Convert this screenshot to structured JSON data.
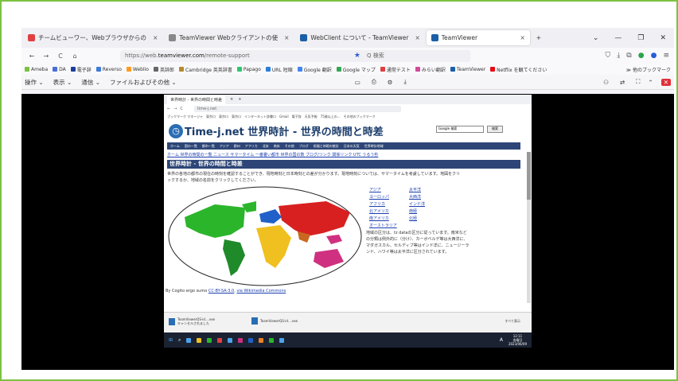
{
  "tabs": [
    {
      "label": "チームビューワー、Webブラウザからの",
      "fav_color": "#4a6ed8"
    },
    {
      "label": "TeamViewer Webクライアントの使",
      "fav_color": "#6b6b6b"
    },
    {
      "label": "WebClient について - TeamViewer",
      "fav_color": "#1b5fa6"
    },
    {
      "label": "TeamViewer",
      "fav_color": "#1b5fa6"
    }
  ],
  "tab_close": "×",
  "new_tab": "+",
  "window_controls": [
    "⌄",
    "—",
    "❐",
    "✕"
  ],
  "nav": {
    "back": "←",
    "forward": "→",
    "reload": "C",
    "home": "⌂",
    "url_prefix": "https://web.",
    "url_host": "teamviewer.com",
    "url_suffix": "/remote-support",
    "search": "Q 検索"
  },
  "bookmarks": [
    {
      "label": "Ameba",
      "color": "#7ac142"
    },
    {
      "label": "DA",
      "color": "#4a6ed8"
    },
    {
      "label": "電子辞",
      "color": "#1b3f99"
    },
    {
      "label": "Reverso",
      "color": "#3c7bd6"
    },
    {
      "label": "Weblio",
      "color": "#ff9a1f"
    },
    {
      "label": "英辞郎",
      "color": "#666"
    },
    {
      "label": "Cambridge 英英辞書",
      "color": "#b4892e"
    },
    {
      "label": "Papago",
      "color": "#2ec56d"
    },
    {
      "label": "URL 短縮",
      "color": "#2a80d8"
    },
    {
      "label": "Google 翻訳",
      "color": "#4285f4"
    },
    {
      "label": "Google マップ",
      "color": "#34a853"
    },
    {
      "label": "通常テスト",
      "color": "#e04040"
    },
    {
      "label": "みらい翻訳",
      "color": "#d04b9a"
    },
    {
      "label": "TeamViewer",
      "color": "#1b5fa6"
    },
    {
      "label": "Netflix を観てください",
      "color": "#e50914"
    }
  ],
  "bookmarks_other": "≫ 他のブックマーク",
  "tv_menu": [
    "操作 ⌄",
    "表示 ⌄",
    "通信 ⌄",
    "ファイルおよびその他 ⌄"
  ],
  "inner": {
    "tab_label": "世界時計 - 世界の時間と時差",
    "url": "time-j.net",
    "bookmarks_line": "ブックマーク マネージャ　東京ロ　東京ロ　東京ロ　インターネット辞書ロ　Gmail　電子辞　天気予報　75歳以上の...　その他のブックマーク",
    "site_title": "Time-j.net 世界時計 - 世界の時間と時差",
    "search_placeholder": "Google 検索",
    "search_button": "検索",
    "nav": [
      "ホーム",
      "国の一覧",
      "都市一覧",
      "アジア",
      "欧州",
      "アフリカ",
      "北米",
      "南米",
      "その他",
      "ブログ",
      "祝福と休暇の統計",
      "日本の天気",
      "世界時計地域"
    ],
    "sublinks": "ホーム 世界の時間の一覧 ニュース サマータイム 一番暑い都市 世界の国の数 ブログ/リンク 関係リンク UTC うるう秒",
    "heading": "世界時計 - 世界の時間と時差",
    "intro": "世界の各地の都市の現在の時刻を確認することができ、現地時刻と日本時刻との差が分かります。現地時刻については、サマータイムを考慮しています。地図をクリックするか、地域の名前をクリックしてください。",
    "regions1": [
      "アジア",
      "ヨーロッパ",
      "アフリカ",
      "北アメリカ",
      "南アメリカ",
      "オーストラリア"
    ],
    "regions2": [
      "太平洋",
      "大西洋",
      "インド洋",
      "南極",
      "北極"
    ],
    "region_note": "地域の区分は、tz dataの区分に従っています。南米などの分類は例外的に（分け）、カーボベルデ等は大西洋に、マダガスカル、セルディブ等はインド洋に、ニュージーランド、ハワイ等は太平洋に区分されています。",
    "credit_prefix": "By Cogito ergo sumo ",
    "credit_link1": "CC-BY-SA-3.0",
    "credit_mid": ", ",
    "credit_link2": "via Wikimedia Commons",
    "downloads": [
      {
        "name": "TeamViewerQS-id....exe",
        "sub": "キャンセルされました"
      },
      {
        "name": "TeamViewerQS-id....exe",
        "sub": ""
      }
    ],
    "show_all": "すべて表示",
    "clock_time": "12:11",
    "clock_day": "金曜日",
    "clock_date": "2023/06/09",
    "ime": "A"
  }
}
